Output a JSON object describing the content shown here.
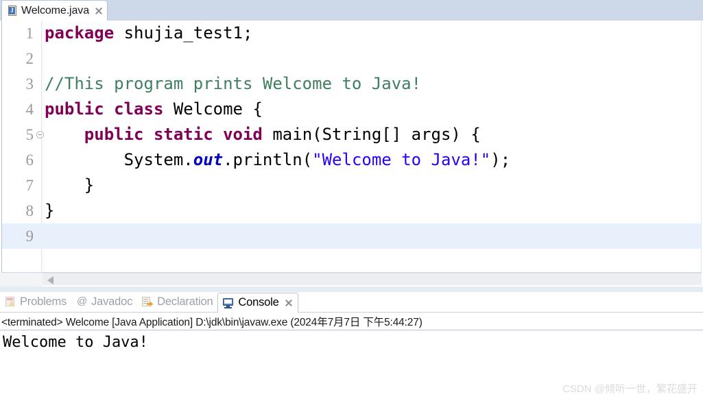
{
  "editor": {
    "tab": {
      "label": "Welcome.java",
      "icon": "java-file-icon",
      "close_icon": "close-icon"
    },
    "lines": [
      {
        "number": "1",
        "fold": false,
        "tokens": [
          {
            "text": "package ",
            "style": "kw"
          },
          {
            "text": "shujia_test1;",
            "style": "plain"
          }
        ]
      },
      {
        "number": "2",
        "fold": false,
        "tokens": []
      },
      {
        "number": "3",
        "fold": false,
        "tokens": [
          {
            "text": "//This program prints Welcome to Java!",
            "style": "cmt"
          }
        ]
      },
      {
        "number": "4",
        "fold": false,
        "tokens": [
          {
            "text": "public class ",
            "style": "kw"
          },
          {
            "text": "Welcome {",
            "style": "plain"
          }
        ]
      },
      {
        "number": "5",
        "fold": true,
        "tokens": [
          {
            "text": "    ",
            "style": "plain"
          },
          {
            "text": "public static void ",
            "style": "kw"
          },
          {
            "text": "main(String[] args) {",
            "style": "plain"
          }
        ]
      },
      {
        "number": "6",
        "fold": false,
        "tokens": [
          {
            "text": "        System.",
            "style": "plain"
          },
          {
            "text": "out",
            "style": "stfield"
          },
          {
            "text": ".println(",
            "style": "plain"
          },
          {
            "text": "\"Welcome to Java!\"",
            "style": "str"
          },
          {
            "text": ");",
            "style": "plain"
          }
        ]
      },
      {
        "number": "7",
        "fold": false,
        "tokens": [
          {
            "text": "    }",
            "style": "plain"
          }
        ]
      },
      {
        "number": "8",
        "fold": false,
        "tokens": [
          {
            "text": "}",
            "style": "plain"
          }
        ]
      },
      {
        "number": "9",
        "fold": false,
        "current": true,
        "tokens": []
      }
    ],
    "scrollbar": {
      "left_arrow_icon": "scroll-left-arrow-icon"
    }
  },
  "console_panel": {
    "tabs": [
      {
        "label": "Problems",
        "icon": "problems-icon",
        "active": false
      },
      {
        "label": "Javadoc",
        "icon": "javadoc-at-icon",
        "active": false
      },
      {
        "label": "Declaration",
        "icon": "declaration-icon",
        "active": false
      },
      {
        "label": "Console",
        "icon": "console-monitor-icon",
        "active": true
      }
    ],
    "active_tab_close_icon": "close-icon",
    "status_line": "<terminated> Welcome [Java Application] D:\\jdk\\bin\\javaw.exe (2024年7月7日 下午5:44:27)",
    "output_lines": [
      "Welcome to Java!"
    ]
  },
  "watermark": "CSDN @倾听一世，繁花盛开",
  "colors": {
    "keyword": "#7F0055",
    "comment": "#3F7F5F",
    "string": "#2A00FF",
    "static_field": "#0000C0",
    "line_number": "#9A9A9A",
    "current_line_highlight": "#E8F0FB",
    "tab_bar_background": "#CDD9E8",
    "console_icon_blue": "#4D7FC4"
  }
}
